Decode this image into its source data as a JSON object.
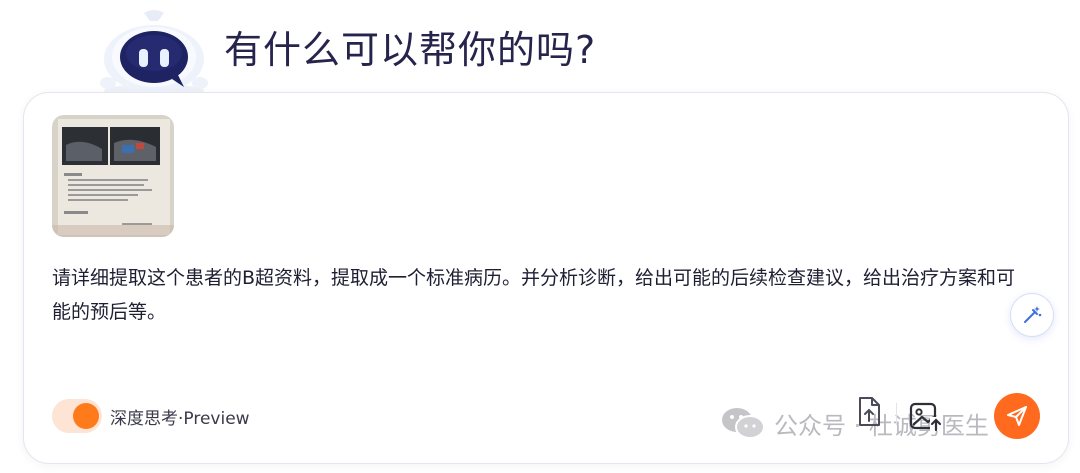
{
  "header": {
    "title": "有什么可以帮你的吗?",
    "mascot_icon": "robot-mascot-icon"
  },
  "composer": {
    "attachment_icon": "document-photo-thumbnail",
    "prompt_text": "请详细提取这个患者的B超资料，提取成一个标准病历。并分析诊断，给出可能的后续检查建议，给出治疗方案和可能的预后等。",
    "magic_icon": "magic-wand-icon",
    "deep_think_label": "深度思考·Preview",
    "deep_think_enabled": true,
    "attach_icon": "attach-file-icon",
    "image_icon": "image-upload-icon",
    "send_icon": "send-icon"
  },
  "watermark": {
    "text": "公众号 · 杜诚勇医生"
  },
  "colors": {
    "accent": "#ff6a1f",
    "title": "#26244c",
    "mascot_dark": "#1e2363",
    "magic_blue": "#3f6fe0"
  }
}
